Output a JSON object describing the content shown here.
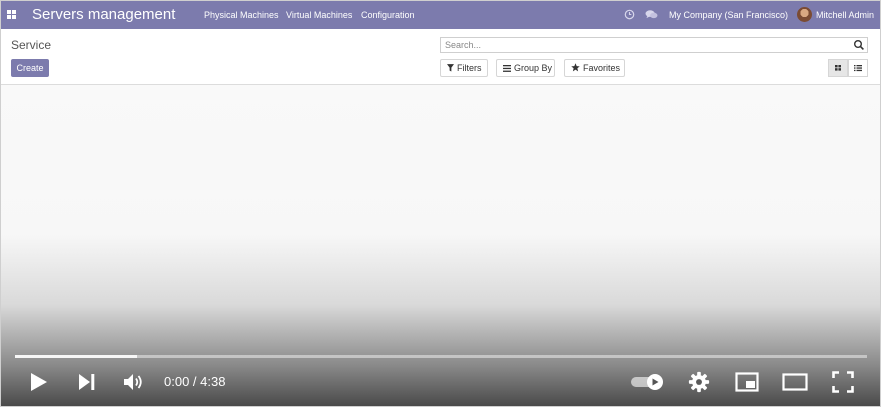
{
  "navbar": {
    "brand": "Servers management",
    "menu": [
      "Physical Machines",
      "Virtual Machines",
      "Configuration"
    ],
    "company": "My Company (San Francisco)",
    "user": "Mitchell Admin",
    "color": "#7c7bad"
  },
  "control_panel": {
    "breadcrumb": "Service",
    "create_label": "Create",
    "search_placeholder": "Search...",
    "filters_label": "Filters",
    "group_by_label": "Group By",
    "favorites_label": "Favorites",
    "active_view": "kanban"
  },
  "video": {
    "current_time": "0:00",
    "separator": " / ",
    "duration": "4:38",
    "progress_buffered": 0.143,
    "autoplay_on": true
  }
}
